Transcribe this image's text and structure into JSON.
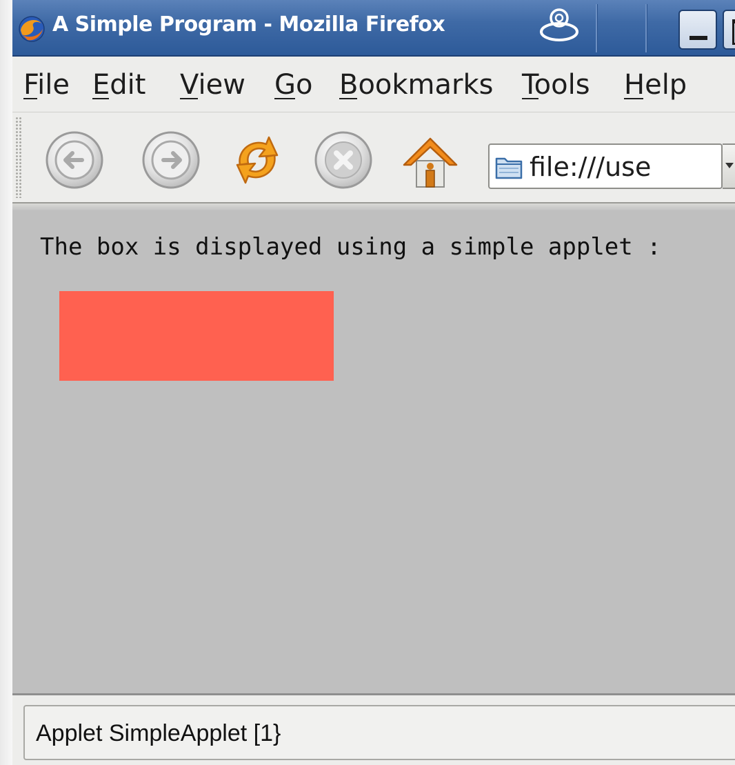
{
  "window": {
    "title": "A Simple Program - Mozilla Firefox"
  },
  "menu": [
    {
      "label": "File",
      "access_key": "F"
    },
    {
      "label": "Edit",
      "access_key": "E"
    },
    {
      "label": "View",
      "access_key": "V"
    },
    {
      "label": "Go",
      "access_key": "G"
    },
    {
      "label": "Bookmarks",
      "access_key": "B"
    },
    {
      "label": "Tools",
      "access_key": "T"
    },
    {
      "label": "Help",
      "access_key": "H"
    }
  ],
  "toolbar": {
    "buttons": [
      {
        "icon": "back-icon"
      },
      {
        "icon": "forward-icon"
      },
      {
        "icon": "reload-icon"
      },
      {
        "icon": "stop-icon"
      },
      {
        "icon": "home-icon"
      }
    ],
    "url": "file:///use"
  },
  "content": {
    "text": "The box is displayed using a simple applet :",
    "applet_color": "#ff6150"
  },
  "status": {
    "text": "Applet SimpleApplet [1}"
  },
  "colors": {
    "titlebar": "#3f6aa6",
    "content_bg": "#bfbfbf",
    "chrome_bg": "#ededeb"
  }
}
